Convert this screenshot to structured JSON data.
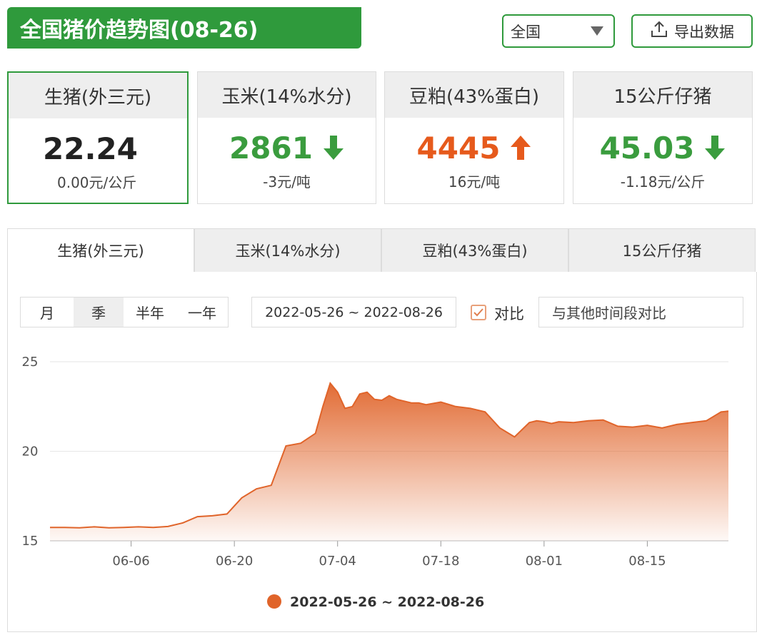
{
  "header": {
    "title": "全国猪价趋势图(08-26)",
    "region": "全国",
    "export_label": "导出数据"
  },
  "cards": [
    {
      "name": "生猪(外三元)",
      "value": "22.24",
      "change": "0.00元/公斤",
      "trend": "flat",
      "color": "#222222"
    },
    {
      "name": "玉米(14%水分)",
      "value": "2861",
      "change": "-3元/吨",
      "trend": "down",
      "color": "#3a9c3e"
    },
    {
      "name": "豆粕(43%蛋白)",
      "value": "4445",
      "change": "16元/吨",
      "trend": "up",
      "color": "#e65a1c"
    },
    {
      "name": "15公斤仔猪",
      "value": "45.03",
      "change": "-1.18元/公斤",
      "trend": "down",
      "color": "#3a9c3e"
    }
  ],
  "tabs": [
    "生猪(外三元)",
    "玉米(14%水分)",
    "豆粕(43%蛋白)",
    "15公斤仔猪"
  ],
  "controls": {
    "periods": [
      "月",
      "季",
      "半年",
      "一年"
    ],
    "active_period": "季",
    "date_range": "2022-05-26 ~ 2022-08-26",
    "compare_label": "对比",
    "compare_placeholder": "与其他时间段对比"
  },
  "colors": {
    "brand_green": "#2f9a3c",
    "series": "#e0642a",
    "up": "#e65a1c",
    "down": "#3a9c3e"
  },
  "chart_data": {
    "type": "area",
    "ylim": [
      15,
      25
    ],
    "y_ticks": [
      "15",
      "20",
      "25"
    ],
    "x_range": [
      "2022-05-26",
      "2022-08-26"
    ],
    "x_ticks": [
      "06-06",
      "06-20",
      "07-04",
      "07-18",
      "08-01",
      "08-15"
    ],
    "legend": "2022-05-26 ~ 2022-08-26",
    "legend_position": "bottom",
    "grid": true,
    "series": [
      {
        "name": "2022-05-26 ~ 2022-08-26",
        "x": [
          "2022-05-26",
          "2022-05-28",
          "2022-05-30",
          "2022-06-01",
          "2022-06-03",
          "2022-06-05",
          "2022-06-07",
          "2022-06-09",
          "2022-06-11",
          "2022-06-13",
          "2022-06-15",
          "2022-06-17",
          "2022-06-19",
          "2022-06-21",
          "2022-06-23",
          "2022-06-25",
          "2022-06-27",
          "2022-06-29",
          "2022-07-01",
          "2022-07-02",
          "2022-07-03",
          "2022-07-04",
          "2022-07-05",
          "2022-07-06",
          "2022-07-07",
          "2022-07-08",
          "2022-07-09",
          "2022-07-10",
          "2022-07-11",
          "2022-07-12",
          "2022-07-13",
          "2022-07-14",
          "2022-07-15",
          "2022-07-16",
          "2022-07-18",
          "2022-07-20",
          "2022-07-22",
          "2022-07-24",
          "2022-07-26",
          "2022-07-28",
          "2022-07-30",
          "2022-07-31",
          "2022-08-01",
          "2022-08-02",
          "2022-08-03",
          "2022-08-05",
          "2022-08-07",
          "2022-08-09",
          "2022-08-11",
          "2022-08-13",
          "2022-08-15",
          "2022-08-17",
          "2022-08-19",
          "2022-08-21",
          "2022-08-23",
          "2022-08-25",
          "2022-08-26"
        ],
        "values": [
          15.75,
          15.75,
          15.73,
          15.78,
          15.73,
          15.75,
          15.78,
          15.75,
          15.8,
          16.0,
          16.35,
          16.4,
          16.5,
          17.4,
          17.9,
          18.1,
          20.3,
          20.45,
          21.0,
          22.5,
          23.8,
          23.3,
          22.4,
          22.5,
          23.2,
          23.3,
          22.9,
          22.85,
          23.1,
          22.9,
          22.8,
          22.7,
          22.7,
          22.6,
          22.75,
          22.5,
          22.4,
          22.2,
          21.3,
          20.8,
          21.6,
          21.7,
          21.65,
          21.55,
          21.65,
          21.6,
          21.7,
          21.75,
          21.4,
          21.35,
          21.45,
          21.3,
          21.5,
          21.6,
          21.7,
          22.2,
          22.24
        ]
      }
    ]
  }
}
